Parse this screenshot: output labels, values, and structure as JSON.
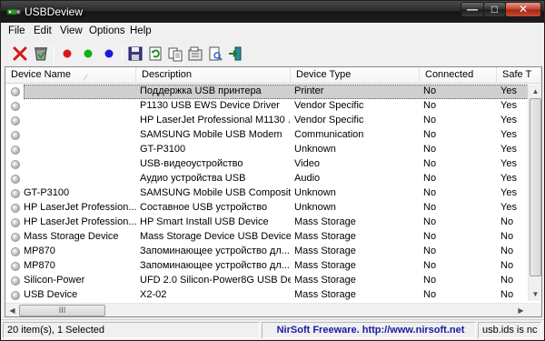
{
  "window": {
    "title": "USBDeview"
  },
  "menu": [
    "File",
    "Edit",
    "View",
    "Options",
    "Help"
  ],
  "toolbar": {
    "icons": [
      "delete-icon",
      "uninstall-icon",
      "red-dot-icon",
      "green-dot-icon",
      "blue-dot-icon",
      "save-icon",
      "refresh-icon",
      "copy-icon",
      "properties-icon",
      "report-icon",
      "exit-icon"
    ],
    "colors": {
      "red": "#d81818",
      "green": "#10b010",
      "blue": "#1a1ad8"
    }
  },
  "columns": [
    "Device Name",
    "Description",
    "Device Type",
    "Connected",
    "Safe T"
  ],
  "rows": [
    {
      "name": "",
      "description": "Поддержка USB принтера",
      "type": "Printer",
      "connected": "No",
      "safe": "Yes",
      "selected": true
    },
    {
      "name": "",
      "description": "P1130 USB EWS Device Driver",
      "type": "Vendor Specific",
      "connected": "No",
      "safe": "Yes"
    },
    {
      "name": "",
      "description": "HP LaserJet Professional M1130 ...",
      "type": "Vendor Specific",
      "connected": "No",
      "safe": "Yes"
    },
    {
      "name": "",
      "description": "SAMSUNG Mobile USB Modem",
      "type": "Communication",
      "connected": "No",
      "safe": "Yes"
    },
    {
      "name": "",
      "description": "GT-P3100",
      "type": "Unknown",
      "connected": "No",
      "safe": "Yes"
    },
    {
      "name": "",
      "description": "USB-видеоустройство",
      "type": "Video",
      "connected": "No",
      "safe": "Yes"
    },
    {
      "name": "",
      "description": "Аудио устройства USB",
      "type": "Audio",
      "connected": "No",
      "safe": "Yes"
    },
    {
      "name": "GT-P3100",
      "description": "SAMSUNG Mobile USB Composite...",
      "type": "Unknown",
      "connected": "No",
      "safe": "Yes"
    },
    {
      "name": "HP LaserJet Profession...",
      "description": "Составное USB устройство",
      "type": "Unknown",
      "connected": "No",
      "safe": "Yes"
    },
    {
      "name": "HP LaserJet Profession...",
      "description": "HP Smart Install USB Device",
      "type": "Mass Storage",
      "connected": "No",
      "safe": "No"
    },
    {
      "name": "Mass Storage Device",
      "description": "Mass Storage Device USB Device",
      "type": "Mass Storage",
      "connected": "No",
      "safe": "No"
    },
    {
      "name": "MP870",
      "description": "Запоминающее устройство дл...",
      "type": "Mass Storage",
      "connected": "No",
      "safe": "No"
    },
    {
      "name": "MP870",
      "description": "Запоминающее устройство дл...",
      "type": "Mass Storage",
      "connected": "No",
      "safe": "No"
    },
    {
      "name": "Silicon-Power",
      "description": "UFD 2.0 Silicon-Power8G USB De...",
      "type": "Mass Storage",
      "connected": "No",
      "safe": "No"
    },
    {
      "name": "USB Device",
      "description": "X2-02",
      "type": "Mass Storage",
      "connected": "No",
      "safe": "No"
    }
  ],
  "scroll": {
    "h_thumb_glyph": "III"
  },
  "status": {
    "count": "20 item(s), 1 Selected",
    "freeware": "NirSoft Freeware.  http://www.nirsoft.net",
    "ids": "usb.ids is nc"
  }
}
